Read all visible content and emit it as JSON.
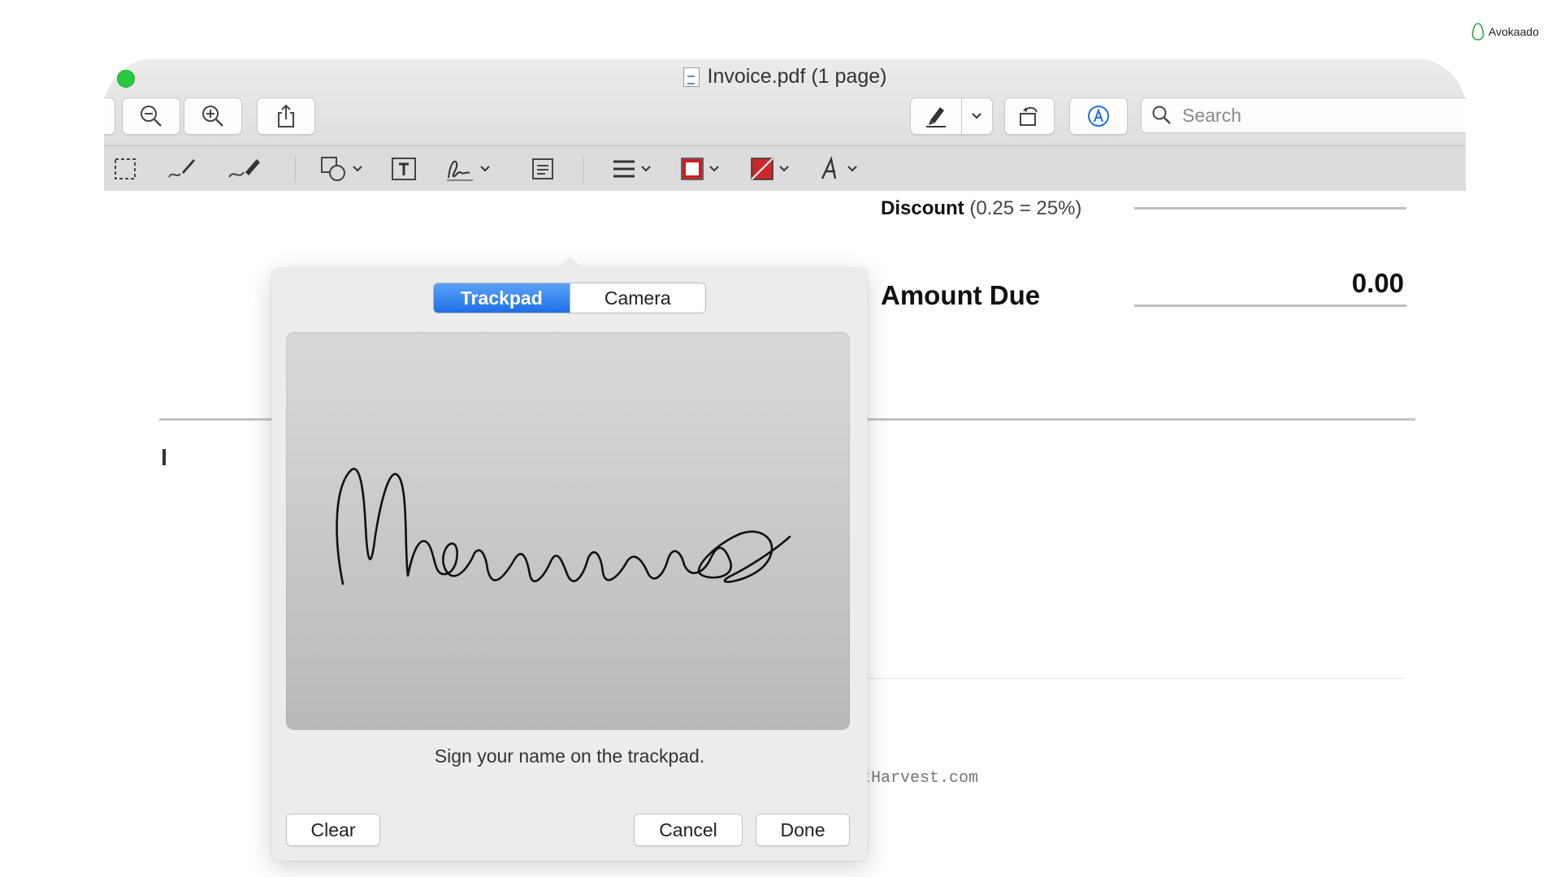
{
  "brand": {
    "name": "Avokaado",
    "icon": "avocado-icon"
  },
  "window": {
    "title": "Invoice.pdf (1 page)",
    "title_icon": "pdf-document-icon",
    "traffic_light_color": "#27c93f"
  },
  "toolbar": {
    "zoom_out_icon": "zoom-out-icon",
    "zoom_in_icon": "zoom-in-icon",
    "share_icon": "share-icon",
    "highlight_icon": "highlighter-icon",
    "rotate_icon": "rotate-icon",
    "markup_icon": "markup-icon",
    "search_placeholder": "Search"
  },
  "markup_toolbar": {
    "tools": [
      "rectangular-selection-icon",
      "sketch-icon",
      "draw-icon",
      "shapes-icon",
      "text-box-icon",
      "signature-icon",
      "note-icon",
      "shape-style-icon",
      "border-color-icon",
      "fill-color-icon",
      "text-style-icon"
    ],
    "border_color": "#cc1f1f",
    "fill_color": "#c8282a"
  },
  "pdf": {
    "discount_label": "Discount",
    "discount_hint": "(0.25 = 25%)",
    "amount_due_label": "Amount Due",
    "amount_due_value": "0.00",
    "footer_text": "s at www.getHarvest.com"
  },
  "signature_popover": {
    "tabs": [
      {
        "label": "Trackpad",
        "active": true
      },
      {
        "label": "Camera",
        "active": false
      }
    ],
    "instruction": "Sign your name on the trackpad.",
    "signature_text": "Macumore",
    "clear_label": "Clear",
    "cancel_label": "Cancel",
    "done_label": "Done",
    "accent_color": "#1f6fe6"
  }
}
